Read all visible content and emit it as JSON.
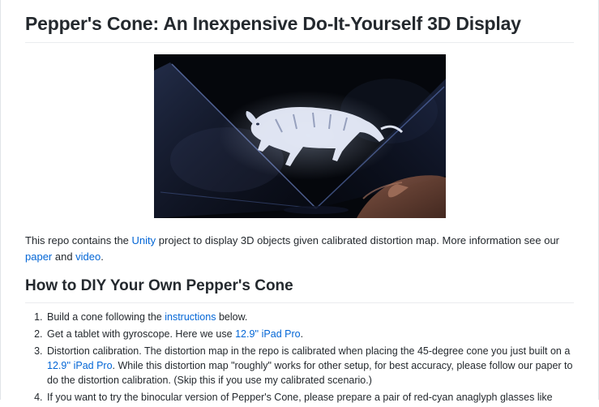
{
  "title": "Pepper's Cone: An Inexpensive Do-It-Yourself 3D Display",
  "hero": {
    "alt": "Hologram of a white tiger inside a clear plastic cone on a tablet"
  },
  "intro": {
    "pre_unity": "This repo contains the ",
    "unity_link": "Unity",
    "post_unity": " project to display 3D objects given calibrated distortion map. More information see our ",
    "paper_link": "paper",
    "and_text": " and ",
    "video_link": "video",
    "end_text": "."
  },
  "section": {
    "title": "How to DIY Your Own Pepper's Cone"
  },
  "steps": [
    {
      "pre": "Build a cone following the ",
      "link": "instructions",
      "post": " below."
    },
    {
      "pre": "Get a tablet with gyroscope. Here we use ",
      "link": "12.9'' iPad Pro",
      "post": "."
    },
    {
      "pre": "Distortion calibration. The distortion map in the repo is calibrated when placing the 45-degree cone you just built on a ",
      "link": "12.9'' iPad Pro",
      "post": ". While this distortion map \"roughly\" works for other setup, for best accuracy, please follow our paper to do the distortion calibration. (Skip this if you use my calibrated scenario.)"
    },
    {
      "pre": "If you want to try the binocular version of Pepper's Cone, please prepare a pair of red-cyan anaglyph glasses like",
      "link": "",
      "post": ""
    }
  ]
}
